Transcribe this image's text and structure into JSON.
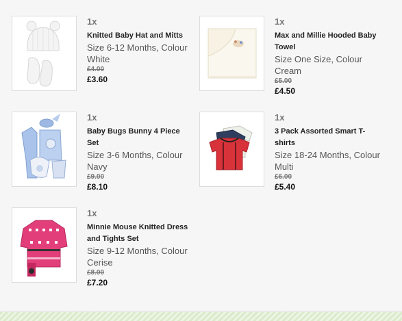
{
  "items": [
    {
      "qty": "1x",
      "name": "Knitted Baby Hat and Mitts",
      "attrs": "Size 6-12 Months, Colour White",
      "was_price": "£4.00",
      "now_price": "£3.60",
      "image": "knitted-hat-mitts-image"
    },
    {
      "qty": "1x",
      "name": "Max and Millie Hooded Baby Towel",
      "attrs": "Size One Size, Colour Cream",
      "was_price": "£5.00",
      "now_price": "£4.50",
      "image": "hooded-towel-image"
    },
    {
      "qty": "1x",
      "name": "Baby Bugs Bunny 4 Piece Set",
      "attrs": "Size 3-6 Months, Colour Navy",
      "was_price": "£9.00",
      "now_price": "£8.10",
      "image": "bugs-bunny-set-image"
    },
    {
      "qty": "1x",
      "name": "3 Pack Assorted Smart T-shirts",
      "attrs": "Size 18-24 Months, Colour Multi",
      "was_price": "£6.00",
      "now_price": "£5.40",
      "image": "tshirts-image"
    },
    {
      "qty": "1x",
      "name": "Minnie Mouse Knitted Dress and Tights Set",
      "attrs": "Size 9-12 Months, Colour Cerise",
      "was_price": "£8.00",
      "now_price": "£7.20",
      "image": "minnie-dress-image"
    }
  ]
}
